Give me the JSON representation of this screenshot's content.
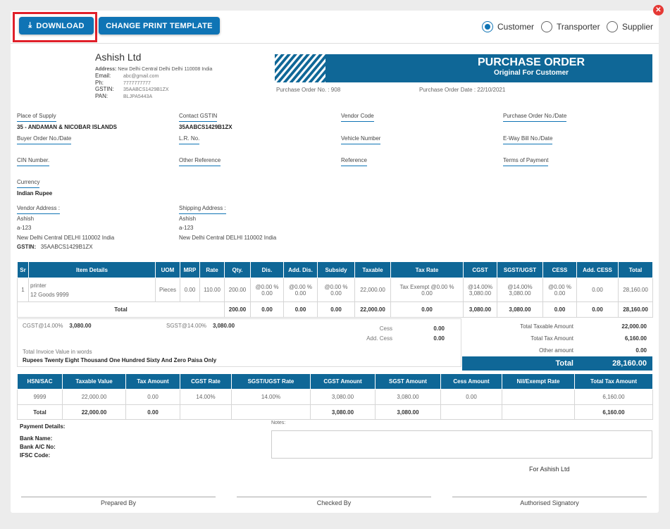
{
  "toolbar": {
    "download": "DOWNLOAD",
    "change_template": "CHANGE PRINT TEMPLATE",
    "radios": [
      "Customer",
      "Transporter",
      "Supplier"
    ],
    "selected": "Customer"
  },
  "company": {
    "name": "Ashish Ltd",
    "address_label": "Address:",
    "address": "New Delhi Central Delhi Delhi 110008 India",
    "email_label": "Email:",
    "email": "abc@gmail.com",
    "ph_label": "Ph:",
    "ph": "7777777777",
    "gstin_label": "GSTIN:",
    "gstin": "35AABCS1429B1ZX",
    "pan_label": "PAN:",
    "pan": "BLJPA5443A"
  },
  "po": {
    "title": "PURCHASE ORDER",
    "subtitle": "Original For Customer",
    "number": "Purchase Order No. : 908",
    "date": "Purchase Order Date : 22/10/2021"
  },
  "fields": [
    {
      "label": "Place of Supply",
      "value": "35 - ANDAMAN & NICOBAR ISLANDS"
    },
    {
      "label": "Contact GSTIN",
      "value": "35AABCS1429B1ZX"
    },
    {
      "label": "Vendor Code",
      "value": ""
    },
    {
      "label": "Purchase Order No./Date",
      "value": ""
    },
    {
      "label": "Buyer Order No./Date",
      "value": ""
    },
    {
      "label": "L.R. No.",
      "value": ""
    },
    {
      "label": "Vehicle Number",
      "value": ""
    },
    {
      "label": "E-Way Bill No./Date",
      "value": ""
    },
    {
      "label": "CIN Number.",
      "value": ""
    },
    {
      "label": "Other Reference",
      "value": ""
    },
    {
      "label": "Reference",
      "value": ""
    },
    {
      "label": "Terms of Payment",
      "value": ""
    },
    {
      "label": "Currency",
      "value": "Indian Rupee"
    }
  ],
  "vendor": {
    "label": "Vendor Address :",
    "name": "Ashish",
    "line1": "a-123",
    "line2": "New Delhi Central DELHI 110002 India",
    "gstin_label": "GSTIN:",
    "gstin": "35AABCS1429B1ZX"
  },
  "shipping": {
    "label": "Shipping Address :",
    "name": "Ashish",
    "line1": "a-123",
    "line2": "New Delhi Central DELHI 110002 India"
  },
  "items": {
    "headers": [
      "Sr",
      "Item Details",
      "UOM",
      "MRP",
      "Rate",
      "Qty.",
      "Dis.",
      "Add. Dis.",
      "Subsidy",
      "Taxable",
      "Tax Rate",
      "CGST",
      "SGST/UGST",
      "CESS",
      "Add. CESS",
      "Total"
    ],
    "rows": [
      {
        "sr": "1",
        "name": "printer",
        "desc": "12 Goods 9999",
        "uom": "Pieces",
        "mrp": "0.00",
        "rate": "110.00",
        "qty": "200.00",
        "dis_pct": "@0.00 %",
        "dis": "0.00",
        "adis_pct": "@0.00 %",
        "adis": "0.00",
        "sub_pct": "@0.00 %",
        "sub": "0.00",
        "taxable": "22,000.00",
        "taxrate": "Tax Exempt @0.00 %",
        "taxrate_amt": "0.00",
        "cgst_pct": "@14.00%",
        "cgst": "3,080.00",
        "sgst_pct": "@14.00%",
        "sgst": "3,080.00",
        "cess_pct": "@0.00 %",
        "cess": "0.00",
        "acess": "0.00",
        "total": "28,160.00"
      }
    ],
    "total": {
      "label": "Total",
      "qty": "200.00",
      "dis": "0.00",
      "adis": "0.00",
      "sub": "0.00",
      "taxable": "22,000.00",
      "taxrate": "0.00",
      "cgst": "3,080.00",
      "sgst": "3,080.00",
      "cess": "0.00",
      "acess": "0.00",
      "total": "28,160.00"
    }
  },
  "summary": {
    "cgst_label": "CGST@14.00%",
    "cgst": "3,080.00",
    "sgst_label": "SGST@14.00%",
    "sgst": "3,080.00",
    "cess_label": "Cess",
    "cess": "0.00",
    "acess_label": "Add. Cess",
    "acess": "0.00",
    "words_label": "Total Invoice Value in words",
    "words": "Rupees Twenty Eight Thousand One Hundred Sixty And Zero Paisa Only",
    "taxable_label": "Total Taxable Amount",
    "taxable": "22,000.00",
    "tax_label": "Total Tax Amount",
    "tax": "6,160.00",
    "other_label": "Other amount",
    "other": "0.00",
    "total_label": "Total",
    "total": "28,160.00"
  },
  "hsn": {
    "headers": [
      "HSN/SAC",
      "Taxable Value",
      "Tax Amount",
      "CGST Rate",
      "SGST/UGST Rate",
      "CGST Amount",
      "SGST Amount",
      "Cess Amount",
      "Nil/Exempt Rate",
      "Total Tax Amount"
    ],
    "row": [
      "9999",
      "22,000.00",
      "0.00",
      "14.00%",
      "14.00%",
      "3,080.00",
      "3,080.00",
      "0.00",
      "",
      "6,160.00"
    ],
    "total": [
      "Total",
      "22,000.00",
      "0.00",
      "",
      "",
      "3,080.00",
      "3,080.00",
      "",
      "",
      "6,160.00"
    ]
  },
  "payment": {
    "title": "Payment Details:",
    "bank": "Bank Name:",
    "ac": "Bank A/C No:",
    "ifsc": "IFSC Code:"
  },
  "notes": {
    "label": "Notes:"
  },
  "footer": {
    "for": "For Ashish Ltd",
    "prepared": "Prepared By",
    "checked": "Checked By",
    "signatory": "Authorised Signatory"
  }
}
